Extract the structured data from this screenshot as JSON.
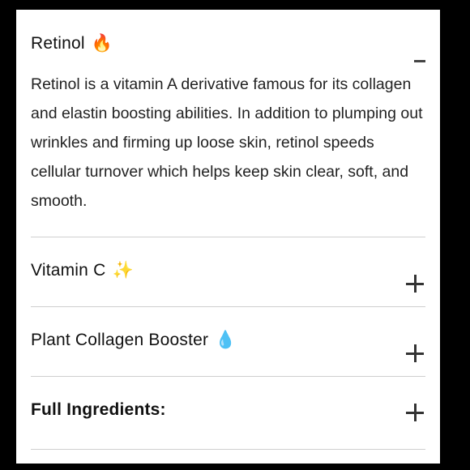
{
  "accordion": {
    "items": [
      {
        "title": "Retinol",
        "emoji": "🔥",
        "icon": "fire-icon",
        "state": "expanded",
        "body": "Retinol is a vitamin A derivative famous for its collagen and elastin boosting abilities. In addition to plumping out wrinkles and firming up loose skin, retinol speeds cellular turnover which helps keep skin clear, soft, and smooth."
      },
      {
        "title": "Vitamin C",
        "emoji": "✨",
        "icon": "sparkles-icon",
        "state": "collapsed"
      },
      {
        "title": "Plant Collagen Booster",
        "emoji": "💧",
        "icon": "droplet-icon",
        "state": "collapsed"
      },
      {
        "title": "Full Ingredients:",
        "state": "collapsed"
      }
    ]
  }
}
